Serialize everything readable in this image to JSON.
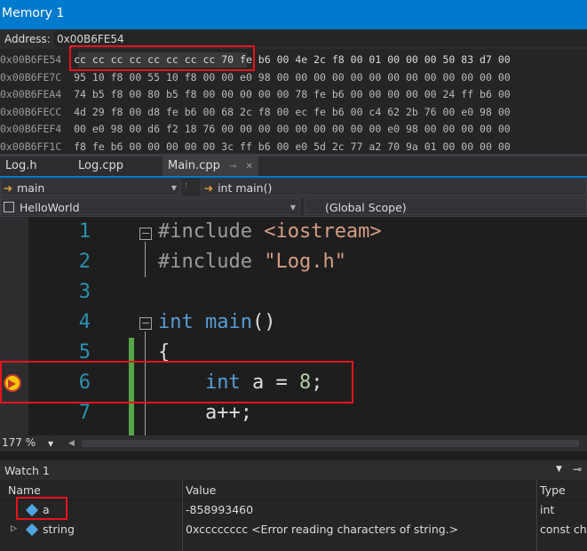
{
  "memory": {
    "title": "Memory 1",
    "address_label": "Address:",
    "address_value": "0x00B6FE54",
    "rows": [
      {
        "addr": "0x00B6FE54",
        "bytes": "cc cc cc cc cc cc cc cc 70 fe b6 00 4e 2c f8 00 01 00 00 00 50 83 d7 00"
      },
      {
        "addr": "0x00B6FE7C",
        "bytes": "95 10 f8 00 55 10 f8 00 00 e0 98 00 00 00 00 00 00 00 00 00 00 00 00 00"
      },
      {
        "addr": "0x00B6FEA4",
        "bytes": "74 b5 f8 00 80 b5 f8 00 00 00 00 00 78 fe b6 00 00 00 00 00 24 ff b6 00"
      },
      {
        "addr": "0x00B6FECC",
        "bytes": "4d 29 f8 00 d8 fe b6 00 68 2c f8 00 ec fe b6 00 c4 62 2b 76 00 e0 98 00"
      },
      {
        "addr": "0x00B6FEF4",
        "bytes": "00 e0 98 00 d6 f2 18 76 00 00 00 00 00 00 00 00 00 e0 98 00 00 00 00 00"
      },
      {
        "addr": "0x00B6FF1C",
        "bytes": "f8 fe b6 00 00 00 00 00 3c ff b6 00 e0 5d 2c 77 a2 70 9a 01 00 00 00 00"
      }
    ]
  },
  "tabs": [
    {
      "label": "Log.h"
    },
    {
      "label": "Log.cpp"
    },
    {
      "label": "Main.cpp"
    }
  ],
  "nav": {
    "member": "main",
    "function": "int main()",
    "project": "HelloWorld",
    "scope": "(Global Scope)"
  },
  "editor": {
    "lines": [
      {
        "n": "1",
        "parts": [
          [
            "pp",
            "#include "
          ],
          [
            "str",
            "<iostream>"
          ]
        ]
      },
      {
        "n": "2",
        "parts": [
          [
            "pp",
            "#include "
          ],
          [
            "str",
            "\"Log.h\""
          ]
        ]
      },
      {
        "n": "3",
        "parts": []
      },
      {
        "n": "4",
        "parts": [
          [
            "kw",
            "int"
          ],
          [
            "txt",
            " "
          ],
          [
            "kw",
            "main"
          ],
          [
            "txt",
            "()"
          ]
        ]
      },
      {
        "n": "5",
        "parts": [
          [
            "txt",
            "{"
          ]
        ]
      },
      {
        "n": "6",
        "parts": [
          [
            "txt",
            "    "
          ],
          [
            "kw",
            "int"
          ],
          [
            "txt",
            " a = "
          ],
          [
            "num",
            "8"
          ],
          [
            "txt",
            ";"
          ]
        ]
      },
      {
        "n": "7",
        "parts": [
          [
            "txt",
            "    a++;"
          ]
        ]
      }
    ]
  },
  "zoom": "177 %",
  "watch": {
    "title": "Watch 1",
    "columns": [
      "Name",
      "Value",
      "Type"
    ],
    "rows": [
      {
        "name": "a",
        "value": "-858993460",
        "type": "int"
      },
      {
        "name": "string",
        "value": "0xcccccccc <Error reading characters of string.>",
        "type": "const ch"
      }
    ]
  },
  "colors": {
    "accent": "#007acc",
    "highlight": "#e8141b",
    "line_number": "#2b91af",
    "keyword": "#569cd6"
  }
}
